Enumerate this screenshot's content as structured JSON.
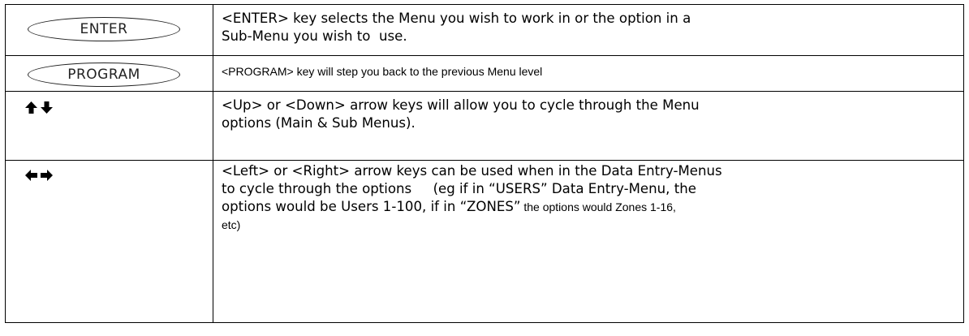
{
  "rows": [
    {
      "key_label": "ENTER",
      "key_icon": "enter-key-button",
      "lines": [
        "<ENTER> key selects the Menu you wish to work in or the option in a",
        "Sub-Menu you wish to  use."
      ]
    },
    {
      "key_label": "PROGRAM",
      "key_icon": "program-key-button",
      "lines": [
        "<PROGRAM> key will step you back to the previous Menu level"
      ]
    },
    {
      "key_icon": "up-down-arrow-icons",
      "lines": [
        "<Up> or <Down> arrow keys will allow you to cycle through the Menu",
        "options (Main & Sub Menus)."
      ]
    },
    {
      "key_icon": "left-right-arrow-icons",
      "lines": [
        "<Left> or <Right> arrow keys can be used when in the Data Entry-Menus",
        "to cycle through the options     (eg if in “USERS” Data Entry-Menu, the",
        "options would be Users 1-100, if in “ZONES”",
        " the options would Zones 1-16,",
        "etc)"
      ]
    }
  ]
}
